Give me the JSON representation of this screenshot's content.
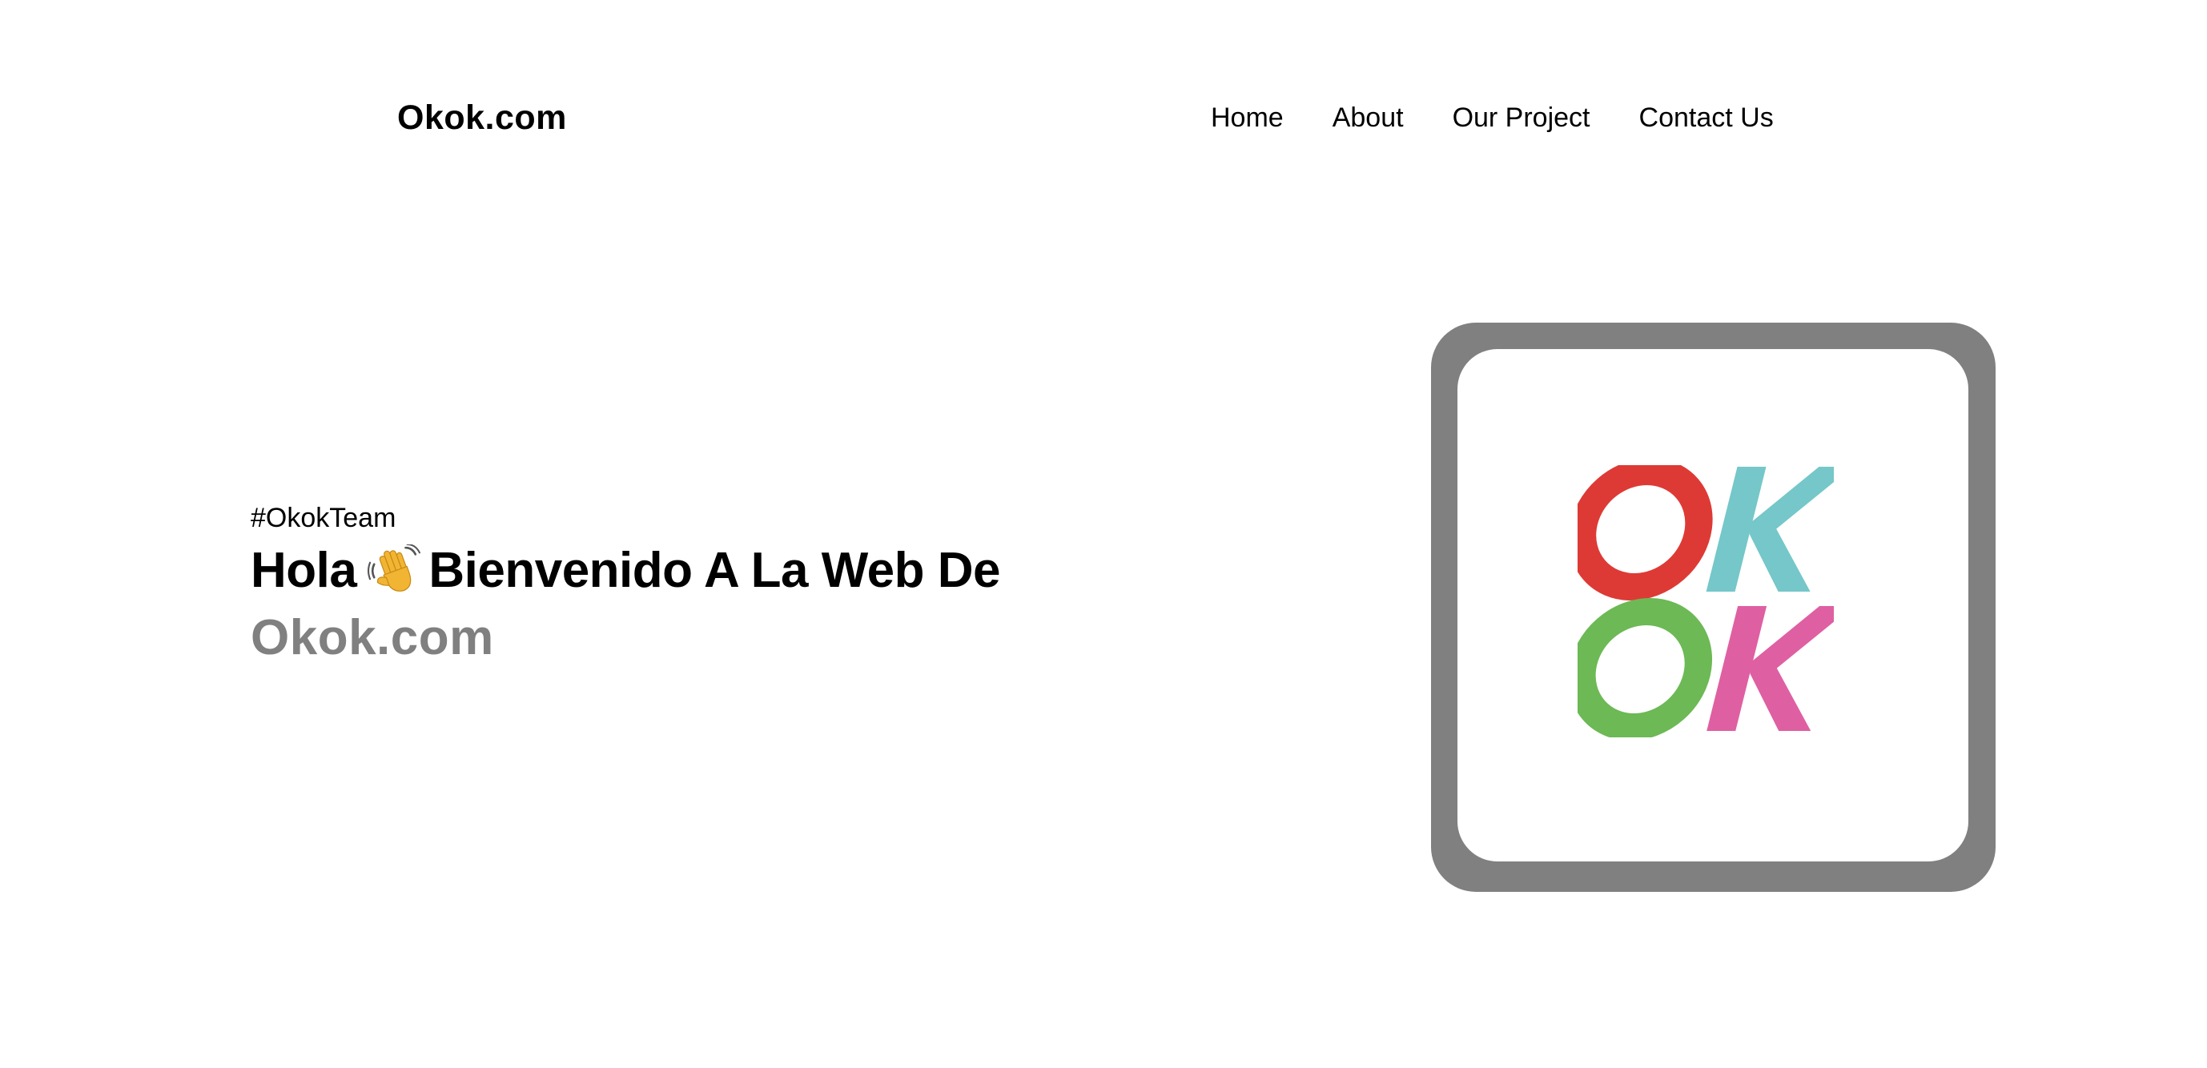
{
  "header": {
    "brand": "Okok.com",
    "nav": [
      {
        "label": "Home"
      },
      {
        "label": "About"
      },
      {
        "label": "Our Project"
      },
      {
        "label": "Contact Us"
      }
    ]
  },
  "hero": {
    "tag": "#OkokTeam",
    "greeting": "Hola",
    "greeting_icon": "waving-hand-icon",
    "headline_rest": "Bienvenido A La Web De",
    "site_name": "Okok.com"
  },
  "logo": {
    "text_top": "OK",
    "text_bottom": "OK",
    "colors": {
      "o_top": "#de3a35",
      "k_top": "#75c7c9",
      "o_bottom": "#6cb955",
      "k_bottom": "#df5fa3"
    }
  },
  "colors": {
    "background": "#ffffff",
    "frame": "#808080",
    "site_name": "#808080",
    "text": "#000000"
  }
}
